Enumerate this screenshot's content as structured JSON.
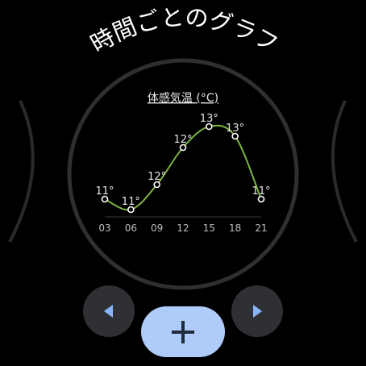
{
  "screen": {
    "title": "時間ごとのグラフ"
  },
  "chart_data": {
    "type": "line",
    "title": "体感気温 (°C)",
    "categories": [
      "03",
      "06",
      "09",
      "12",
      "15",
      "18",
      "21"
    ],
    "values": [
      11,
      11,
      12,
      12,
      13,
      13,
      11
    ],
    "value_labels": [
      "11°",
      "11°",
      "12°",
      "12°",
      "13°",
      "13°",
      "11°"
    ],
    "line_color": "#7cb342",
    "grid": false
  },
  "controls": {
    "prev_icon": "chevron-left-icon",
    "next_icon": "chevron-right-icon",
    "add_icon": "plus-icon",
    "accent": "#8ab4f8"
  }
}
